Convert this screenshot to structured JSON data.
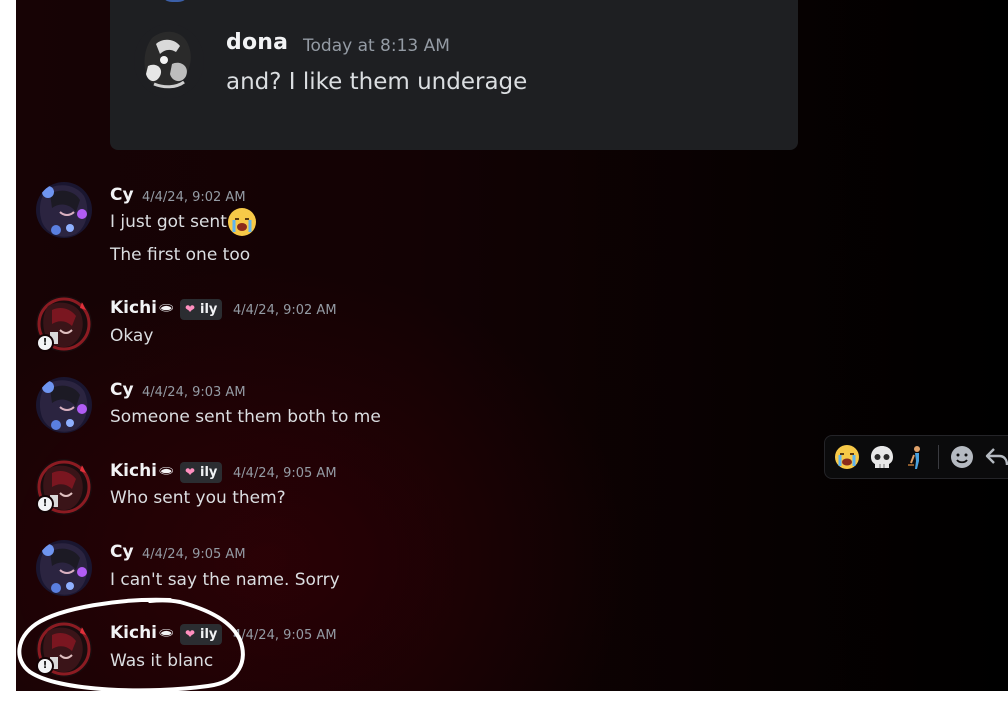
{
  "quoted": {
    "author": "dona",
    "timestamp": "Today at 8:13 AM",
    "text": "and? I like them underage"
  },
  "messages": [
    {
      "author": "Cy",
      "timestamp": "4/4/24, 9:02 AM",
      "lines": [
        "I just got sent",
        "The first one too"
      ],
      "inline_emoji": "loudly-crying-emoji"
    },
    {
      "author": "Kichi",
      "tag_glyph": "🕳",
      "badge": "ily",
      "timestamp": "4/4/24, 9:02 AM",
      "lines": [
        "Okay"
      ]
    },
    {
      "author": "Cy",
      "timestamp": "4/4/24, 9:03 AM",
      "lines": [
        "Someone sent them both to me"
      ]
    },
    {
      "author": "Kichi",
      "tag_glyph": "🕳",
      "badge": "ily",
      "timestamp": "4/4/24, 9:05 AM",
      "lines": [
        "Who sent you them?"
      ]
    },
    {
      "author": "Cy",
      "timestamp": "4/4/24, 9:05 AM",
      "lines": [
        "I can't say the name. Sorry"
      ]
    },
    {
      "author": "Kichi",
      "tag_glyph": "🕳",
      "badge": "ily",
      "timestamp": "4/4/24, 9:05 AM",
      "lines": [
        "Was it blanc"
      ]
    }
  ],
  "toolbar": {
    "reactions": [
      "loudly-crying-emoji",
      "skull-emoji",
      "person-standing-emoji"
    ],
    "actions": [
      "add-reaction-icon",
      "reply-icon"
    ]
  },
  "colors": {
    "username": "#f2f3f5",
    "timestamp": "#949ba4",
    "message_text": "#dbdee1",
    "quote_background": "#1e1f22",
    "badge_heart": "#ff8fbf"
  }
}
